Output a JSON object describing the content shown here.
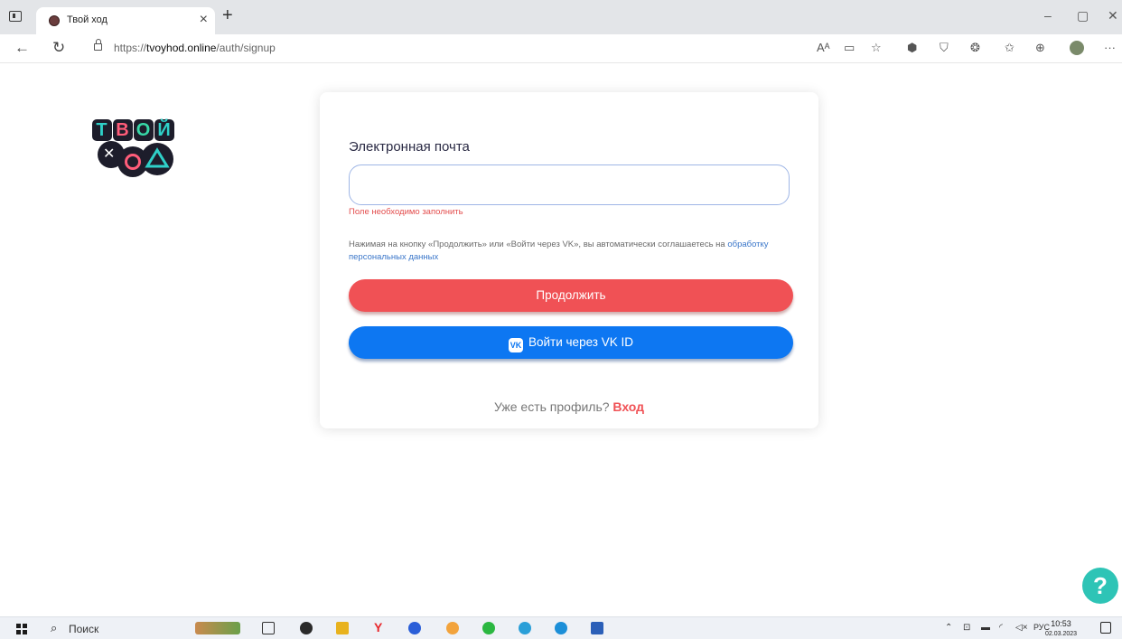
{
  "browser": {
    "tab_title": "Твой ход",
    "tab_close": "×",
    "new_tab": "+",
    "minimize": "–",
    "restore": "▢",
    "close": "✕",
    "url_prefix": "https://",
    "url_host": "tvoyhod.online",
    "url_path": "/auth/signup",
    "more": "···"
  },
  "logo": {
    "letters_top": [
      "Т",
      "В",
      "О",
      "Й"
    ],
    "x_mark": "✕"
  },
  "form": {
    "email_label": "Электронная почта",
    "email_value": "",
    "error": "Поле необходимо заполнить",
    "consent_text": "Нажимая на кнопку «Продолжить» или «Войти через VK», вы автоматически соглашаетесь на ",
    "consent_link": "обработку персональных данных",
    "continue_label": "Продолжить",
    "vk_label": "Войти через VK ID",
    "vk_icon_text": "VK",
    "have_profile": "Уже есть профиль?",
    "login_label": "Вход"
  },
  "help": {
    "label": "?"
  },
  "taskbar": {
    "search_label": "Поиск",
    "lang": "РУС",
    "time": "10:53",
    "date": "02.03.2023"
  },
  "colors": {
    "accent_red": "#f05155",
    "vk_blue": "#0d77f2",
    "help_teal": "#2ec4b6",
    "error": "#e34d4d"
  }
}
